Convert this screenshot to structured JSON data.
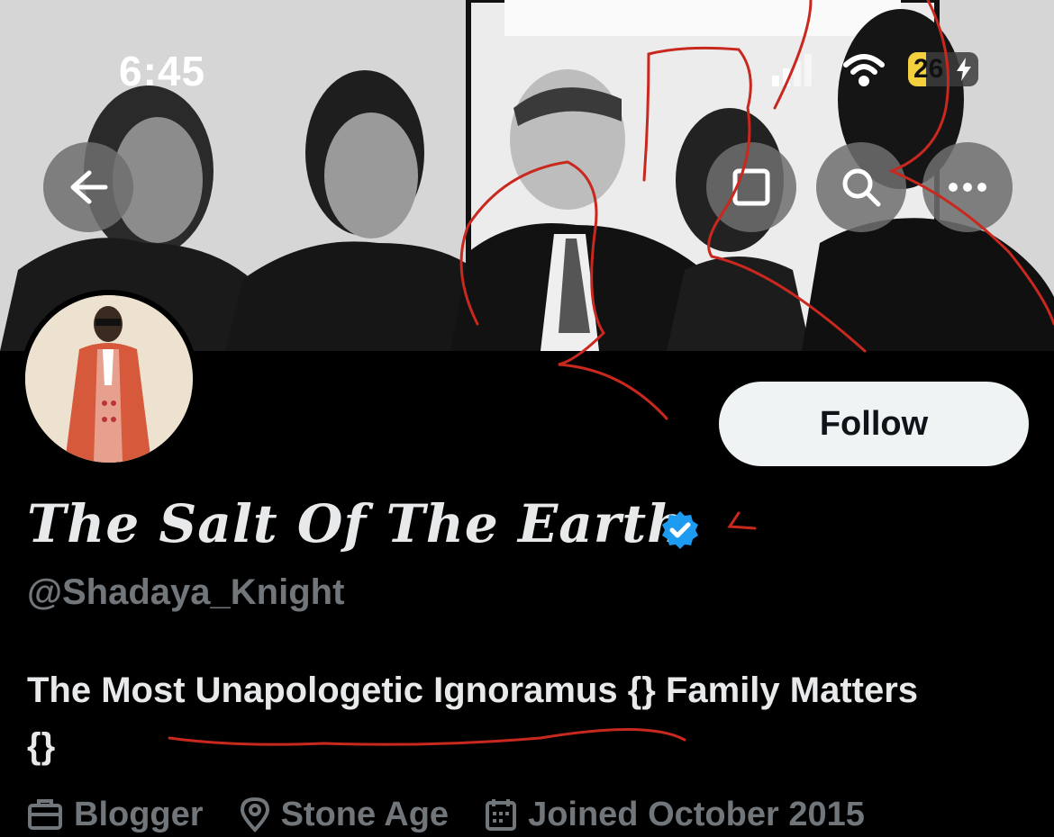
{
  "status_bar": {
    "time": "6:45",
    "battery_label": "26",
    "battery_level": 0.26,
    "icons": [
      "signal-icon",
      "wifi-icon",
      "battery-charging-icon"
    ]
  },
  "header": {
    "back_icon": "back-arrow-icon",
    "actions": [
      "square-icon",
      "search-icon",
      "more-icon"
    ]
  },
  "profile": {
    "follow_label": "Follow",
    "display_name": "The Salt Of The Earth",
    "verified": true,
    "handle": "@Shadaya_Knight",
    "bio": "The Most Unapologetic Ignoramus {} Family Matters {}",
    "meta": [
      {
        "icon": "briefcase-icon",
        "text": "Blogger"
      },
      {
        "icon": "location-pin-icon",
        "text": "Stone Age"
      },
      {
        "icon": "calendar-icon",
        "text": "Joined October 2015"
      }
    ]
  },
  "colors": {
    "background": "#000000",
    "verified_blue": "#1d9bf0",
    "follow_bg": "#eff3f4",
    "secondary_text": "#71767b",
    "annotation_red": "#c8281e"
  }
}
